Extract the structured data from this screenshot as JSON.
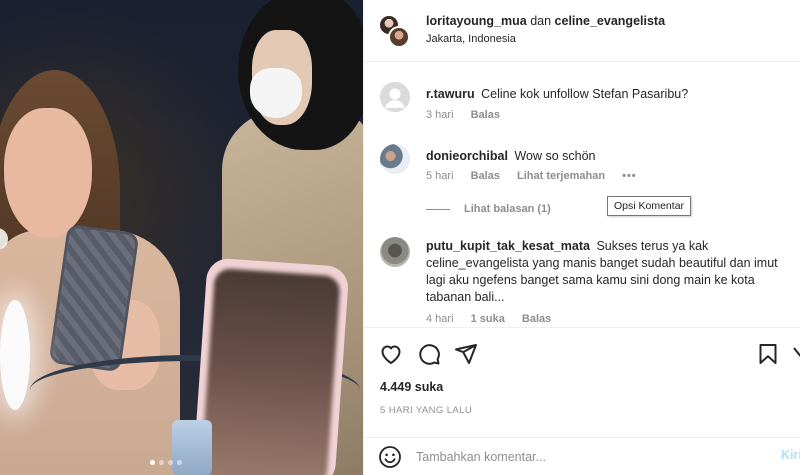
{
  "post": {
    "author": "loritayoung_mua",
    "connector": "dan",
    "coauthor": "celine_evangelista",
    "location": "Jakarta, Indonesia"
  },
  "comments": [
    {
      "user": "r.tawuru",
      "text": "Celine kok unfollow Stefan Pasaribu?",
      "time": "3 hari",
      "reply_label": "Balas"
    },
    {
      "user": "donieorchibal",
      "text": "Wow so schön",
      "time": "5 hari",
      "reply_label": "Balas",
      "translate_label": "Lihat terjemahan",
      "more_label": "•••",
      "view_replies_label": "Lihat balasan (1)"
    },
    {
      "user": "putu_kupit_tak_kesat_mata",
      "text": "Sukses terus ya kak celine_evangelista yang manis banget sudah beautiful dan imut lagi aku ngefens banget sama kamu sini dong main ke kota tabanan bali...",
      "time": "4 hari",
      "likes_label": "1 suka",
      "reply_label": "Balas"
    }
  ],
  "tooltip": "Opsi Komentar",
  "actions": {
    "likes": "4.449 suka",
    "date": "5 HARI YANG LALU"
  },
  "composer": {
    "placeholder": "Tambahkan komentar...",
    "post_label": "Kirim"
  },
  "icons": [
    "heart-icon",
    "comment-icon",
    "share-icon",
    "bookmark-icon",
    "emoji-icon"
  ],
  "colors": {
    "text": "#262626",
    "muted": "#8e8e8e",
    "post_button": "#b2dffc",
    "border": "#efefef"
  }
}
